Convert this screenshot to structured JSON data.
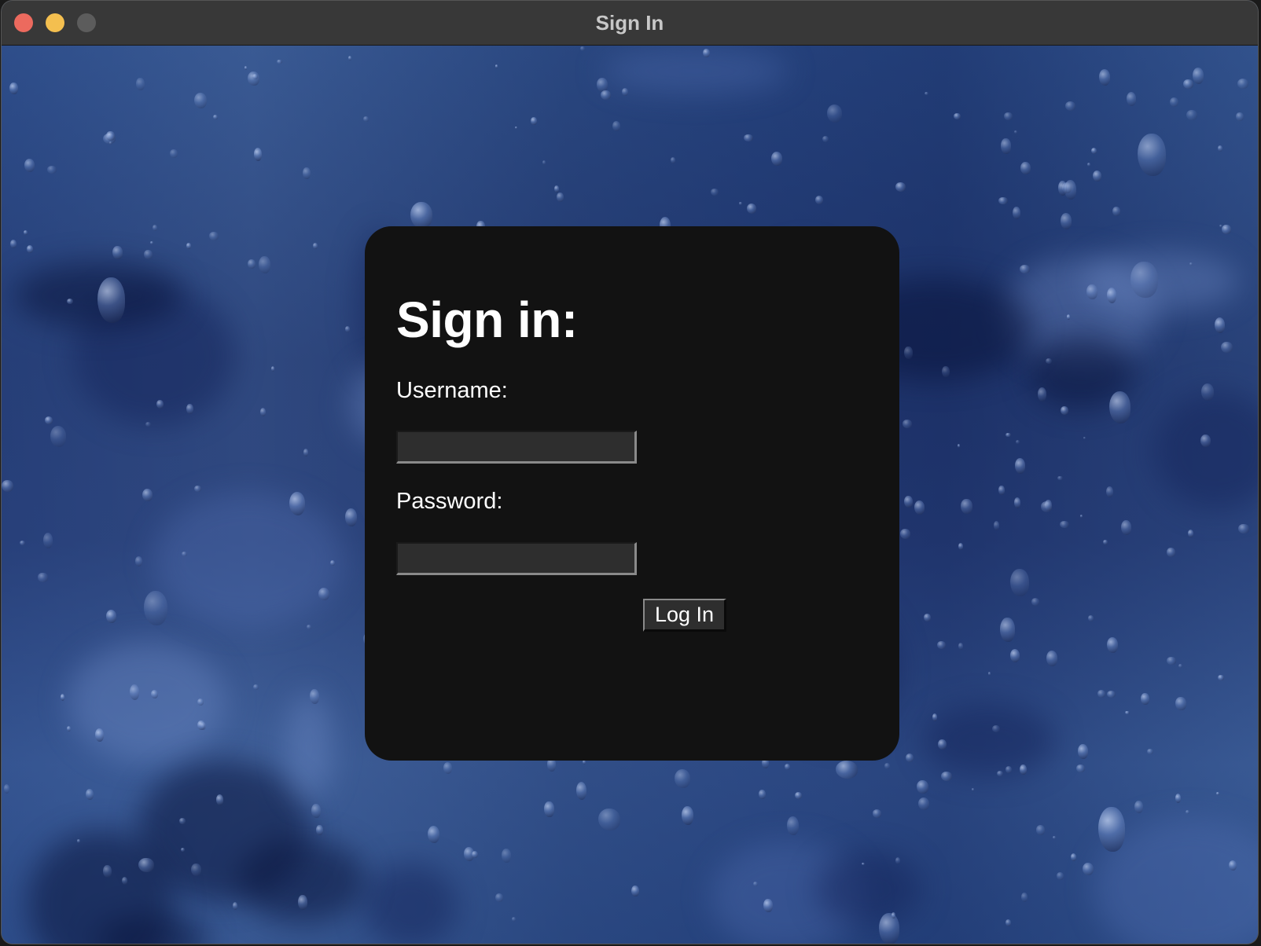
{
  "window": {
    "title": "Sign In",
    "controls": {
      "close_color": "#ec6a5e",
      "minimize_color": "#f4bf4f",
      "zoom_color": "#5c5c5c"
    }
  },
  "background": {
    "description_icon": "rain-on-glass-wallpaper",
    "tint": "#2c4a80"
  },
  "login_card": {
    "heading": "Sign in:",
    "username": {
      "label": "Username:",
      "value": ""
    },
    "password": {
      "label": "Password:",
      "value": ""
    },
    "submit_label": "Log In",
    "card_color": "#121212"
  }
}
